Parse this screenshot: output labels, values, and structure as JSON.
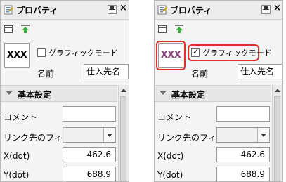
{
  "left_panel": {
    "title": "プロパティ",
    "preview_text": "XXX",
    "checkbox_label": "グラフィックモード",
    "checkbox_checked": false,
    "name_label": "名前",
    "name_value": "仕入先名",
    "section_title": "基本設定",
    "properties": [
      {
        "label": "コメント",
        "type": "text",
        "value": ""
      },
      {
        "label": "リンク先のフィ...",
        "type": "select",
        "value": ""
      },
      {
        "label": "X(dot)",
        "type": "text",
        "value": "462.6"
      },
      {
        "label": "Y(dot)",
        "type": "text",
        "value": "688.9"
      }
    ]
  },
  "right_panel": {
    "title": "プロパティ",
    "preview_text": "XXX",
    "preview_text_color": "#8a3f78",
    "checkbox_label": "グラフィックモード",
    "checkbox_checked": true,
    "checkbox_mark": "✓",
    "name_label": "名前",
    "name_value": "仕入先名",
    "section_title": "基本設定",
    "properties": [
      {
        "label": "コメント",
        "type": "text",
        "value": ""
      },
      {
        "label": "リンク先のフィ...",
        "type": "select",
        "value": ""
      },
      {
        "label": "X(dot)",
        "type": "text",
        "value": "462.6"
      },
      {
        "label": "Y(dot)",
        "type": "text",
        "value": "688.9"
      }
    ],
    "highlight_color": "#e0302a"
  },
  "icons": {
    "title": "properties-sheet-icon",
    "pin": "pin-icon",
    "close": "×",
    "toolbar_a": "window-icon",
    "toolbar_b": "green-arrow-icon"
  }
}
